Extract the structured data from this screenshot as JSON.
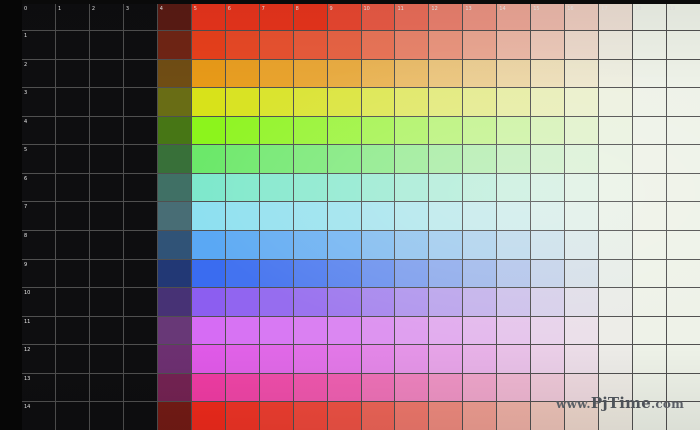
{
  "image": {
    "subject": "projector color test chart photographed on screen",
    "columns": 20,
    "color_rows": 14
  },
  "column_labels": [
    "0",
    "1",
    "2",
    "3",
    "4",
    "5",
    "6",
    "7",
    "8",
    "9",
    "10",
    "11",
    "12",
    "13",
    "14",
    "15",
    "16",
    "17",
    "18",
    "19"
  ],
  "row_labels": [
    "1",
    "2",
    "3",
    "4",
    "5",
    "6",
    "7",
    "8",
    "9",
    "10",
    "11",
    "12",
    "13",
    "14"
  ],
  "hue_rows": [
    {
      "hue": "red-orange",
      "base": "#e8401c"
    },
    {
      "hue": "orange",
      "base": "#e89a18"
    },
    {
      "hue": "yellow",
      "base": "#d8e21a"
    },
    {
      "hue": "yellow-green",
      "base": "#8cf41c"
    },
    {
      "hue": "green",
      "base": "#6ce86a"
    },
    {
      "hue": "aqua",
      "base": "#7ee8cc"
    },
    {
      "hue": "cyan",
      "base": "#8ee0f0"
    },
    {
      "hue": "sky-blue",
      "base": "#5aa8f4"
    },
    {
      "hue": "blue",
      "base": "#3a6cf0"
    },
    {
      "hue": "violet",
      "base": "#8c5ef0"
    },
    {
      "hue": "purple",
      "base": "#d66cf4"
    },
    {
      "hue": "magenta",
      "base": "#e05ae8"
    },
    {
      "hue": "pink",
      "base": "#f03ca4"
    },
    {
      "hue": "red",
      "base": "#f02a1c"
    }
  ],
  "watermark": {
    "prefix": "www.",
    "brand": "PjTime",
    "suffix": ".com"
  }
}
